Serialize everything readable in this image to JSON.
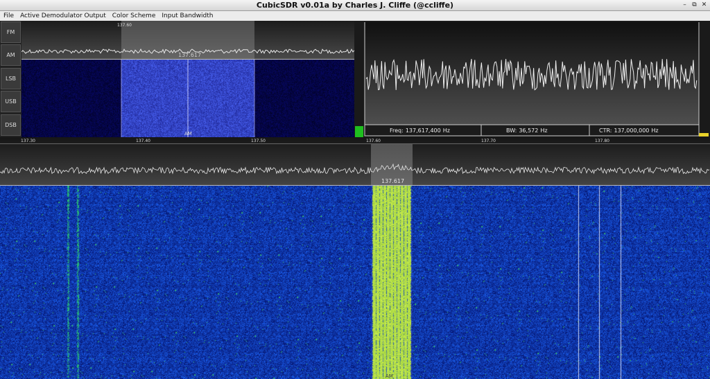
{
  "window": {
    "title": "CubicSDR v0.01a by Charles J. Cliffe (@ccliffe)",
    "buttons": [
      "–",
      "⧉",
      "✕"
    ]
  },
  "menu": [
    {
      "label": "File"
    },
    {
      "label": "Active Demodulator Output"
    },
    {
      "label": "Color Scheme"
    },
    {
      "label": "Input Bandwidth"
    }
  ],
  "demod_modes": [
    {
      "label": "FM",
      "active": false
    },
    {
      "label": "AM",
      "active": true
    },
    {
      "label": "LSB",
      "active": false
    },
    {
      "label": "USB",
      "active": false
    },
    {
      "label": "DSB",
      "active": false
    }
  ],
  "demod_view": {
    "tick_label": "137.60",
    "freq_label": "137.617",
    "mode_label": "AM"
  },
  "scope": {
    "freq_label": "Freq:",
    "freq_value": "137,617,400",
    "freq_unit": "Hz",
    "bw_label": "BW:",
    "bw_value": "36,572",
    "bw_unit": "Hz",
    "ctr_label": "CTR:",
    "ctr_value": "137,000,000",
    "ctr_unit": "Hz"
  },
  "spectrum": {
    "ticks": [
      "137.30",
      "137.40",
      "137.50",
      "137.60",
      "137.70",
      "137.80"
    ],
    "freq_label": "137.617"
  },
  "waterfall": {
    "mode_label": "AM"
  },
  "colors": {
    "waterfall_bg": "#0a1fb0",
    "signal": "#b8ff30",
    "trace": "#e8e8e8",
    "selection": "#9a9a9a"
  }
}
